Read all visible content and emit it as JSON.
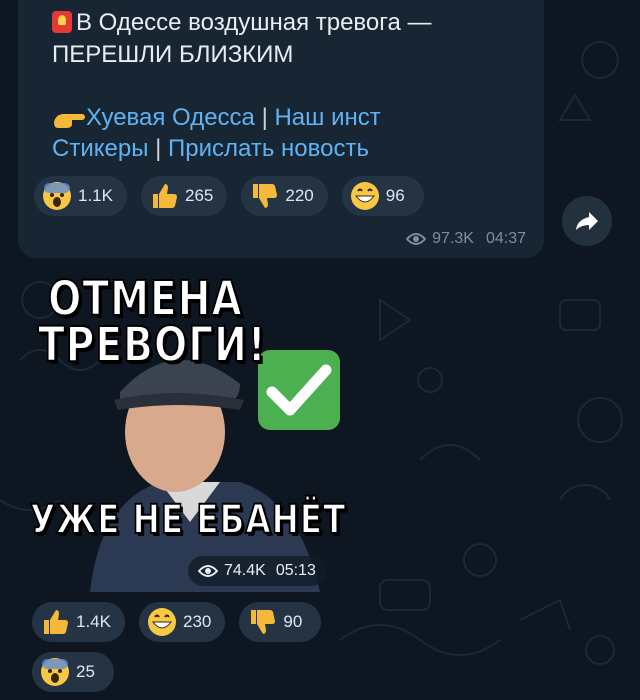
{
  "message": {
    "headline": "В Одессе воздушная тревога —",
    "headline2": "ПЕРЕШЛИ БЛИЗКИМ",
    "channel_link": "Хуевая Одесса",
    "separator": "|",
    "insta_link": "Наш инст",
    "stickers_link": "Стикеры",
    "submit_link": "Прислать новость",
    "reactions": [
      {
        "emoji": "scream-emoji",
        "count": "1.1K"
      },
      {
        "emoji": "thumbs-up-emoji",
        "count": "265"
      },
      {
        "emoji": "thumbs-down-emoji",
        "count": "220"
      },
      {
        "emoji": "grin-emoji",
        "count": "96"
      }
    ],
    "views": "97.3K",
    "time": "04:37"
  },
  "sticker_post": {
    "sticker_text_top1": "ОТМЕНА",
    "sticker_text_top2": "ТРЕВОГИ!",
    "sticker_text_bottom": "УЖЕ НЕ ЕБАНЁТ",
    "views": "74.4K",
    "time": "05:13",
    "reactions": [
      {
        "emoji": "thumbs-up-emoji",
        "count": "1.4K"
      },
      {
        "emoji": "grin-emoji",
        "count": "230"
      },
      {
        "emoji": "thumbs-down-emoji",
        "count": "90"
      },
      {
        "emoji": "scream-emoji",
        "count": "25"
      }
    ]
  },
  "colors": {
    "background": "#0e1621",
    "bubble": "#182533",
    "link": "#5fb3f3",
    "reaction_pill": "#253445",
    "meta": "#7c8fa2"
  }
}
